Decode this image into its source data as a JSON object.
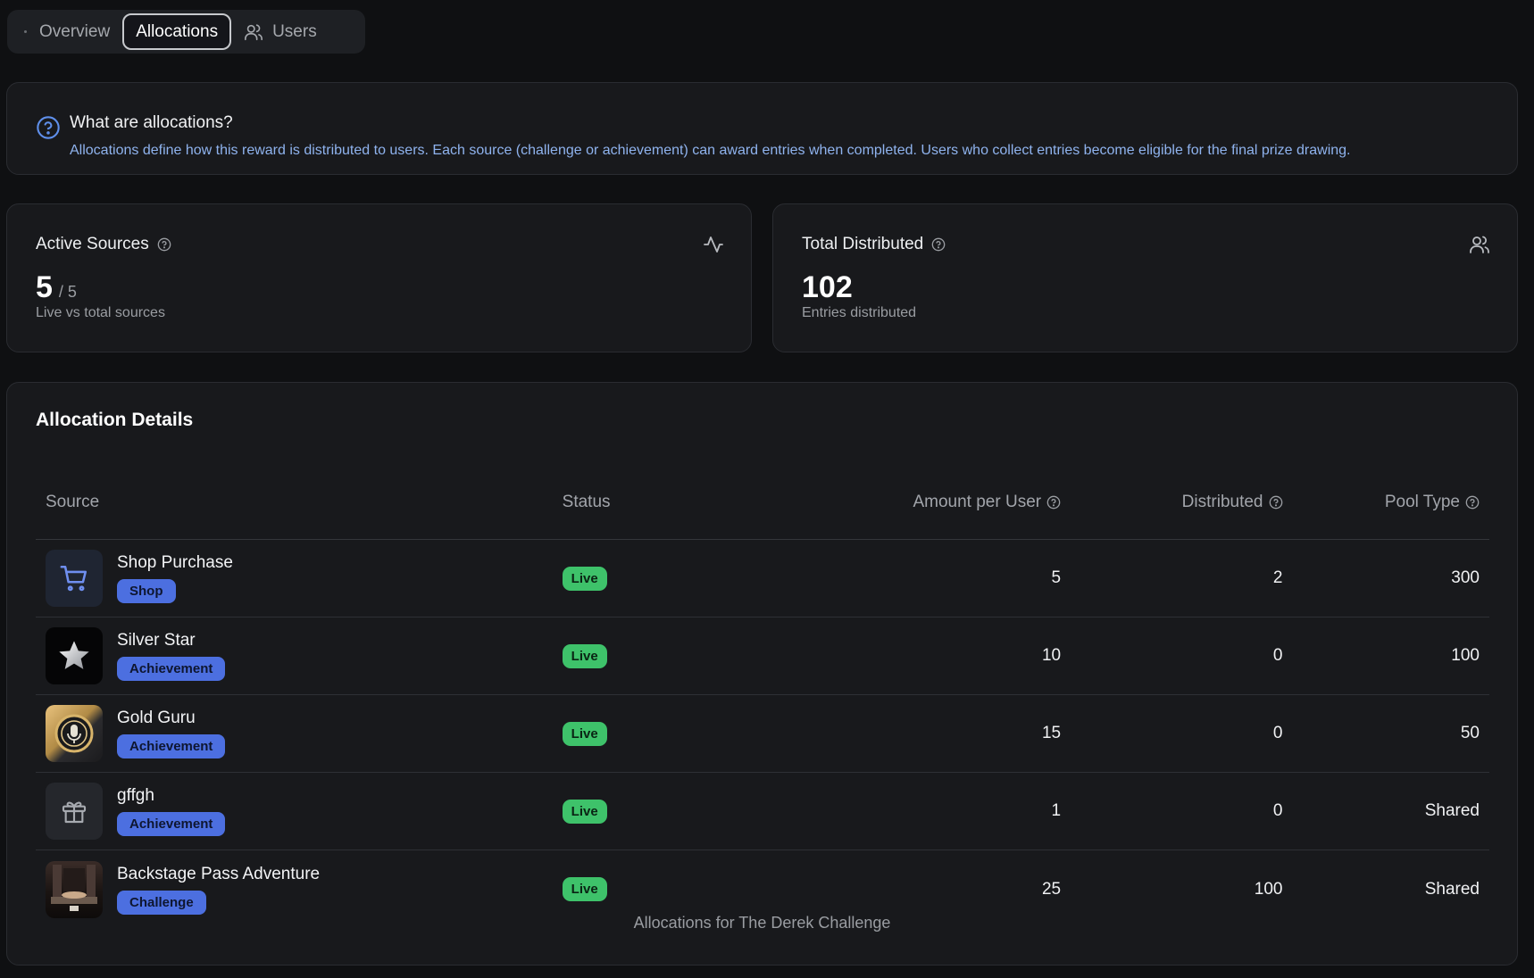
{
  "tabs": [
    {
      "label": "Overview",
      "active": false,
      "icon": "dot-icon"
    },
    {
      "label": "Allocations",
      "active": true
    },
    {
      "label": "Users",
      "active": false,
      "icon": "users-icon"
    }
  ],
  "info": {
    "title": "What are allocations?",
    "text": "Allocations define how this reward is distributed to users. Each source (challenge or achievement) can award entries when completed. Users who collect entries become eligible for the final prize drawing.",
    "icon": "help-circle-icon"
  },
  "stats": {
    "active_sources": {
      "label": "Active Sources",
      "value": "5",
      "total": "/ 5",
      "caption": "Live vs total sources",
      "icon": "activity-icon"
    },
    "total_distributed": {
      "label": "Total Distributed",
      "value": "102",
      "caption": "Entries distributed",
      "icon": "users-icon"
    }
  },
  "details": {
    "title": "Allocation Details",
    "columns": {
      "source": "Source",
      "status": "Status",
      "amount": "Amount per User",
      "distributed": "Distributed",
      "pool": "Pool Type"
    },
    "rows": [
      {
        "name": "Shop Purchase",
        "tag": "Shop",
        "status": "Live",
        "amount": "5",
        "distributed": "2",
        "pool": "300",
        "thumb": "cart-icon"
      },
      {
        "name": "Silver Star",
        "tag": "Achievement",
        "status": "Live",
        "amount": "10",
        "distributed": "0",
        "pool": "100",
        "thumb": "star-badge-icon"
      },
      {
        "name": "Gold Guru",
        "tag": "Achievement",
        "status": "Live",
        "amount": "15",
        "distributed": "0",
        "pool": "50",
        "thumb": "gold-medal-icon"
      },
      {
        "name": "gffgh",
        "tag": "Achievement",
        "status": "Live",
        "amount": "1",
        "distributed": "0",
        "pool": "Shared",
        "thumb": "gift-icon"
      },
      {
        "name": "Backstage Pass Adventure",
        "tag": "Challenge",
        "status": "Live",
        "amount": "25",
        "distributed": "100",
        "pool": "Shared",
        "thumb": "backstage-image"
      }
    ],
    "caption": "Allocations for The Derek Challenge"
  },
  "colors": {
    "background": "#0f1012",
    "card": "#18191c",
    "accent_tag": "#4c6fe0",
    "live_badge": "#3ec26a",
    "info_text": "#8fb3ee"
  }
}
